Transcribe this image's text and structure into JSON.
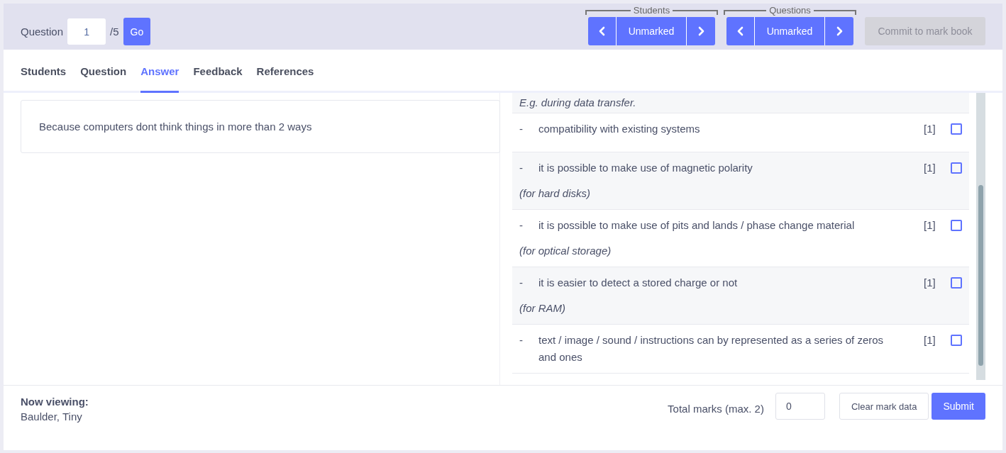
{
  "question_nav": {
    "label": "Question",
    "value": "1",
    "total": "/5",
    "go": "Go"
  },
  "nav_groups": [
    {
      "label": "Students",
      "current": "Unmarked"
    },
    {
      "label": "Questions",
      "current": "Unmarked"
    }
  ],
  "commit_button": {
    "label": "Commit to mark book",
    "disabled": true
  },
  "tabs": [
    {
      "label": "Students",
      "selected": false
    },
    {
      "label": "Question",
      "selected": false
    },
    {
      "label": "Answer",
      "selected": true
    },
    {
      "label": "Feedback",
      "selected": false
    },
    {
      "label": "References",
      "selected": false
    }
  ],
  "answer": {
    "text": "Because computers dont think things in more than 2 ways"
  },
  "mark_scheme": [
    {
      "note": "E.g. during data transfer."
    },
    {
      "bullet": "-",
      "text": "compatibility with existing systems",
      "marks": "[1]",
      "checked": false
    },
    {
      "bullet": "-",
      "text": "it is possible to make use of magnetic polarity",
      "marks": "[1]",
      "checked": false,
      "note": "(for hard disks)"
    },
    {
      "bullet": "-",
      "text": "it is possible to make use of pits and lands / phase change material",
      "marks": "[1]",
      "checked": false,
      "note": "(for optical storage)"
    },
    {
      "bullet": "-",
      "text": "it is easier to detect a stored charge or not",
      "marks": "[1]",
      "checked": false,
      "note": "(for RAM)"
    },
    {
      "bullet": "-",
      "text": "text / image / sound / instructions can by represented as a series of zeros and ones",
      "marks": "[1]",
      "checked": false
    }
  ],
  "footer": {
    "viewing_label": "Now viewing:",
    "student": "Baulder, Tiny",
    "total_label": "Total marks (max. 2)",
    "total_value": "0",
    "clear": "Clear mark data",
    "submit": "Submit"
  }
}
